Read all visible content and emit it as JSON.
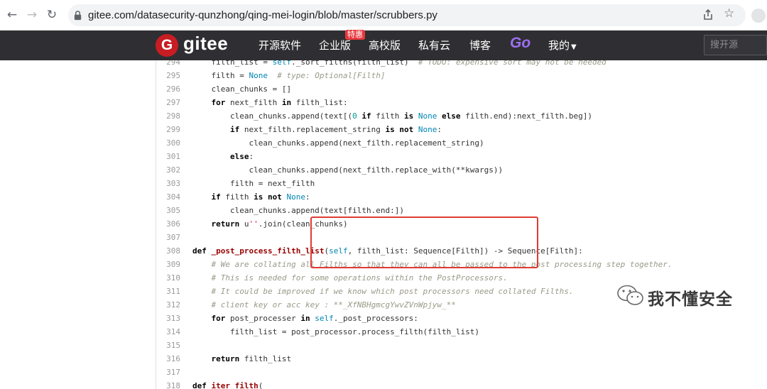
{
  "browser": {
    "url": "gitee.com/datasecurity-qunzhong/qing-mei-login/blob/master/scrubbers.py",
    "back_icon": "arrow-left-icon",
    "forward_icon": "arrow-right-icon",
    "reload_icon": "reload-icon"
  },
  "header": {
    "logo_mark": "G",
    "brand": "gitee",
    "nav": [
      "开源软件",
      "企业版",
      "高校版",
      "私有云",
      "博客"
    ],
    "badge": "特惠",
    "go": "Go",
    "mine": "我的",
    "search_placeholder": "搜开源",
    "accent": "#c71d23",
    "bg": "#2f2f33",
    "go_color": "#9d6ff3"
  },
  "code": {
    "lines": [
      {
        "n": "294",
        "html": "    filth_list = <span class=\"b\">self</span>._sort_filths(filth_list)  <span class=\"c\"># TODO: expensive sort may not be needed</span>"
      },
      {
        "n": "295",
        "html": "    filth = <span class=\"b\">None</span>  <span class=\"c\"># type: Optional[Filth]</span>"
      },
      {
        "n": "296",
        "html": "    clean_chunks = []"
      },
      {
        "n": "297",
        "html": "    <span class=\"k\">for</span> next_filth <span class=\"k\">in</span> filth_list:"
      },
      {
        "n": "298",
        "html": "        clean_chunks.append(text[(<span class=\"num\">0</span> <span class=\"k\">if</span> filth <span class=\"k\">is</span> <span class=\"b\">None</span> <span class=\"k\">else</span> filth.end):next_filth.beg])"
      },
      {
        "n": "299",
        "html": "        <span class=\"k\">if</span> next_filth.replacement_string <span class=\"k\">is not</span> <span class=\"b\">None</span>:"
      },
      {
        "n": "300",
        "html": "            clean_chunks.append(next_filth.replacement_string)"
      },
      {
        "n": "301",
        "html": "        <span class=\"k\">else</span>:"
      },
      {
        "n": "302",
        "html": "            clean_chunks.append(next_filth.replace_with(**kwargs))"
      },
      {
        "n": "303",
        "html": "        filth = next_filth"
      },
      {
        "n": "304",
        "html": "    <span class=\"k\">if</span> filth <span class=\"k\">is not</span> <span class=\"b\">None</span>:"
      },
      {
        "n": "305",
        "html": "        clean_chunks.append(text[filth.end:])"
      },
      {
        "n": "306",
        "html": "    <span class=\"k\">return</span> u<span class=\"s\">''</span>.join(clean_chunks)"
      },
      {
        "n": "307",
        "html": ""
      },
      {
        "n": "308",
        "html": "<span class=\"k\">def</span> <span class=\"f\">_post_process_filth_list</span>(<span class=\"b\">self</span>, filth_list: Sequence[Filth]) -&gt; Sequence[Filth]:"
      },
      {
        "n": "309",
        "html": "    <span class=\"c\"># We are collating all Filths so that they can all be passed to the post processing step together.</span>"
      },
      {
        "n": "310",
        "html": "    <span class=\"c\"># This is needed for some operations within the PostProcessors.</span>"
      },
      {
        "n": "311",
        "html": "    <span class=\"c\"># It could be improved if we know which post processors need collated Filths.</span>"
      },
      {
        "n": "312",
        "html": "    <span class=\"c\"># client key or acc key : **_XfNBHgmcgYwvZVnWpjyw_**</span>"
      },
      {
        "n": "313",
        "html": "    <span class=\"k\">for</span> post_processer <span class=\"k\">in</span> <span class=\"b\">self</span>._post_processors:"
      },
      {
        "n": "314",
        "html": "        filth_list = post_processor.process_filth(filth_list)"
      },
      {
        "n": "315",
        "html": ""
      },
      {
        "n": "316",
        "html": "    <span class=\"k\">return</span> filth_list"
      },
      {
        "n": "317",
        "html": ""
      },
      {
        "n": "318",
        "html": "<span class=\"k\">def</span> <span class=\"f\">iter_filth</span>("
      }
    ]
  },
  "watermark": {
    "text": "我不懂安全",
    "icon": "wechat-icon"
  }
}
